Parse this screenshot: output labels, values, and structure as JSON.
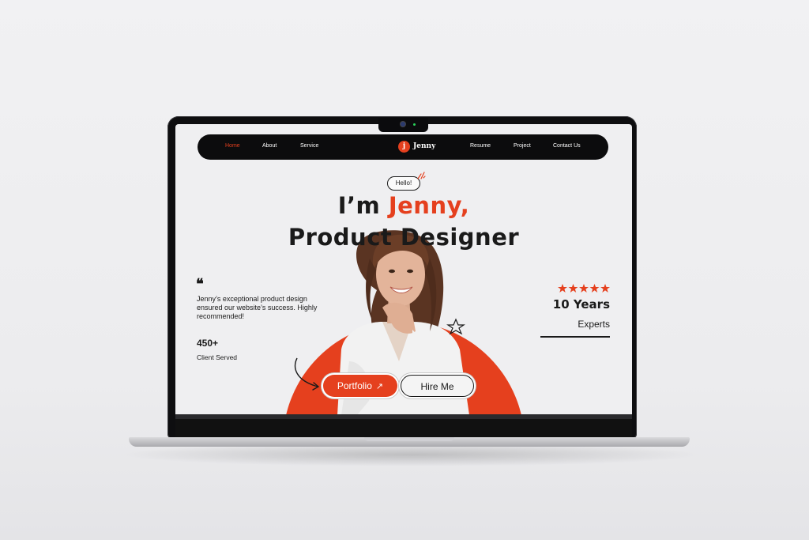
{
  "nav": {
    "items_left": [
      {
        "label": "Home",
        "active": true
      },
      {
        "label": "About",
        "active": false
      },
      {
        "label": "Service",
        "active": false
      }
    ],
    "logo": {
      "mark": "j",
      "text": "Jenny"
    },
    "items_right": [
      {
        "label": "Resume"
      },
      {
        "label": "Project"
      },
      {
        "label": "Contact Us"
      }
    ]
  },
  "hero": {
    "greeting": "Hello!",
    "headline_prefix": "I’m ",
    "headline_name": "Jenny,",
    "headline_role": "Product Designer"
  },
  "testimonial": {
    "quote_mark": "❝",
    "text": "Jenny’s exceptional product design ensured our website’s success. Highly recommended!"
  },
  "stats": {
    "clients_count": "450+",
    "clients_label": "Client Served",
    "rating_stars": 5,
    "years": "10 Years",
    "years_label": "Experts"
  },
  "buttons": {
    "portfolio": "Portfolio",
    "portfolio_icon": "arrow-up-right-icon",
    "hire": "Hire Me"
  },
  "colors": {
    "accent": "#e5401e",
    "dark": "#0c0c0d",
    "screen_bg": "#efeff1"
  }
}
